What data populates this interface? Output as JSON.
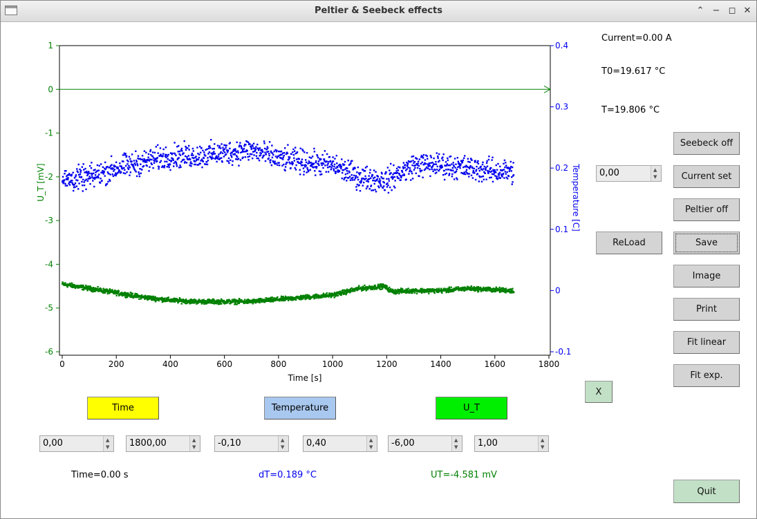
{
  "window": {
    "title": "Peltier & Seebeck effects"
  },
  "status": {
    "current": "Current=0.00 A",
    "t0": "T0=19.617 °C",
    "t": "T=19.806 °C",
    "time": "Time=0.00 s",
    "dt": "dT=0.189 °C",
    "ut": "UT=-4.581 mV"
  },
  "controls": {
    "seebeck": "Seebeck off",
    "current_set": "Current set",
    "current_value": "0,00",
    "peltier": "Peltier off",
    "reload": "ReLoad",
    "save": "Save",
    "image": "Image",
    "print": "Print",
    "fit_linear": "Fit linear",
    "fit_exp": "Fit exp.",
    "x": "X",
    "quit": "Quit"
  },
  "axis_selectors": [
    {
      "label": "Time",
      "color": "#ffff00"
    },
    {
      "label": "Temperature",
      "color": "#a9c8ef"
    },
    {
      "label": "U_T",
      "color": "#00ee00"
    }
  ],
  "ranges": [
    "0,00",
    "1800,00",
    "-0,10",
    "0,40",
    "-6,00",
    "1,00"
  ],
  "colors": {
    "ut": "#008000",
    "temperature": "#0000ee"
  },
  "chart_data": {
    "type": "scatter",
    "xlabel": "Time [s]",
    "ylabel_left": "U_T [mV]",
    "ylabel_right": "Temperature [C]",
    "xlim": [
      0,
      1800
    ],
    "ylim_left": [
      -6,
      1
    ],
    "ylim_right": [
      -0.1,
      0.4
    ],
    "x_ticks": [
      "0",
      "200",
      "400",
      "600",
      "800",
      "1000",
      "1200",
      "1400",
      "1600",
      "1800"
    ],
    "y_left_ticks": [
      "1",
      "0",
      "-1",
      "-2",
      "-3",
      "-4",
      "-5",
      "-6"
    ],
    "y_right_ticks": [
      "0.4",
      "0.3",
      "0.2",
      "0.1",
      "0",
      "-0.1"
    ],
    "grid": false,
    "reference_line": {
      "axis": "left",
      "value": 0
    },
    "series": [
      {
        "axis": "left",
        "color": "#008000",
        "x": [
          0,
          100,
          200,
          300,
          400,
          500,
          600,
          700,
          800,
          900,
          1000,
          1100,
          1190,
          1220,
          1300,
          1400,
          1500,
          1670
        ],
        "y": [
          -4.45,
          -4.55,
          -4.65,
          -4.75,
          -4.82,
          -4.85,
          -4.85,
          -4.85,
          -4.8,
          -4.75,
          -4.7,
          -4.55,
          -4.5,
          -4.62,
          -4.6,
          -4.6,
          -4.55,
          -4.6
        ]
      },
      {
        "axis": "right",
        "color": "#0000ee",
        "x": [
          0,
          100,
          200,
          300,
          400,
          500,
          600,
          700,
          800,
          900,
          1000,
          1100,
          1200,
          1300,
          1400,
          1500,
          1600,
          1670
        ],
        "y": [
          0.18,
          0.185,
          0.2,
          0.21,
          0.22,
          0.22,
          0.225,
          0.23,
          0.215,
          0.21,
          0.205,
          0.185,
          0.18,
          0.205,
          0.205,
          0.2,
          0.195,
          0.195
        ]
      }
    ]
  }
}
